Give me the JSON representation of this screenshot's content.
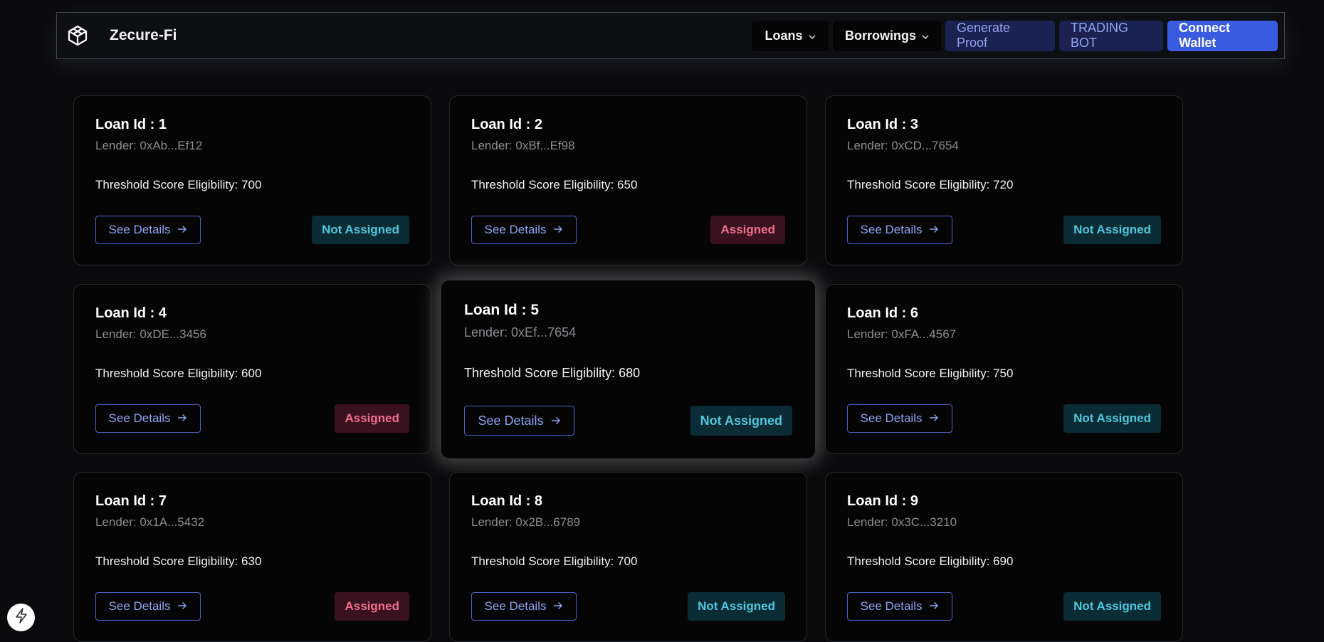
{
  "app": {
    "brand": "Zecure-Fi"
  },
  "nav": {
    "loans_label": "Loans",
    "borrowings_label": "Borrowings",
    "generate_proof_label": "Generate Proof",
    "trading_bot_label": "TRADING BOT",
    "connect_wallet_label": "Connect Wallet"
  },
  "icons": {
    "logo": "cube-logo-icon",
    "chevron": "chevron-down-icon",
    "arrow": "arrow-right-icon",
    "corner": "lightning-icon"
  },
  "colors": {
    "accent": "#3a5ce0",
    "not_assigned_text": "#4fc7dd",
    "assigned_text": "#ef6f8f"
  },
  "loans": [
    {
      "title": "Loan Id : 1",
      "lender": "Lender: 0xAb...Ef12",
      "threshold": "Threshold Score Eligibility: 700",
      "details_label": "See Details",
      "status": "Not Assigned"
    },
    {
      "title": "Loan Id : 2",
      "lender": "Lender: 0xBf...Ef98",
      "threshold": "Threshold Score Eligibility: 650",
      "details_label": "See Details",
      "status": "Assigned"
    },
    {
      "title": "Loan Id : 3",
      "lender": "Lender: 0xCD...7654",
      "threshold": "Threshold Score Eligibility: 720",
      "details_label": "See Details",
      "status": "Not Assigned"
    },
    {
      "title": "Loan Id : 4",
      "lender": "Lender: 0xDE...3456",
      "threshold": "Threshold Score Eligibility: 600",
      "details_label": "See Details",
      "status": "Assigned"
    },
    {
      "title": "Loan Id : 5",
      "lender": "Lender: 0xEf...7654",
      "threshold": "Threshold Score Eligibility: 680",
      "details_label": "See Details",
      "status": "Not Assigned"
    },
    {
      "title": "Loan Id : 6",
      "lender": "Lender: 0xFA...4567",
      "threshold": "Threshold Score Eligibility: 750",
      "details_label": "See Details",
      "status": "Not Assigned"
    },
    {
      "title": "Loan Id : 7",
      "lender": "Lender: 0x1A...5432",
      "threshold": "Threshold Score Eligibility: 630",
      "details_label": "See Details",
      "status": "Assigned"
    },
    {
      "title": "Loan Id : 8",
      "lender": "Lender: 0x2B...6789",
      "threshold": "Threshold Score Eligibility: 700",
      "details_label": "See Details",
      "status": "Not Assigned"
    },
    {
      "title": "Loan Id : 9",
      "lender": "Lender: 0x3C...3210",
      "threshold": "Threshold Score Eligibility: 690",
      "details_label": "See Details",
      "status": "Not Assigned"
    }
  ]
}
